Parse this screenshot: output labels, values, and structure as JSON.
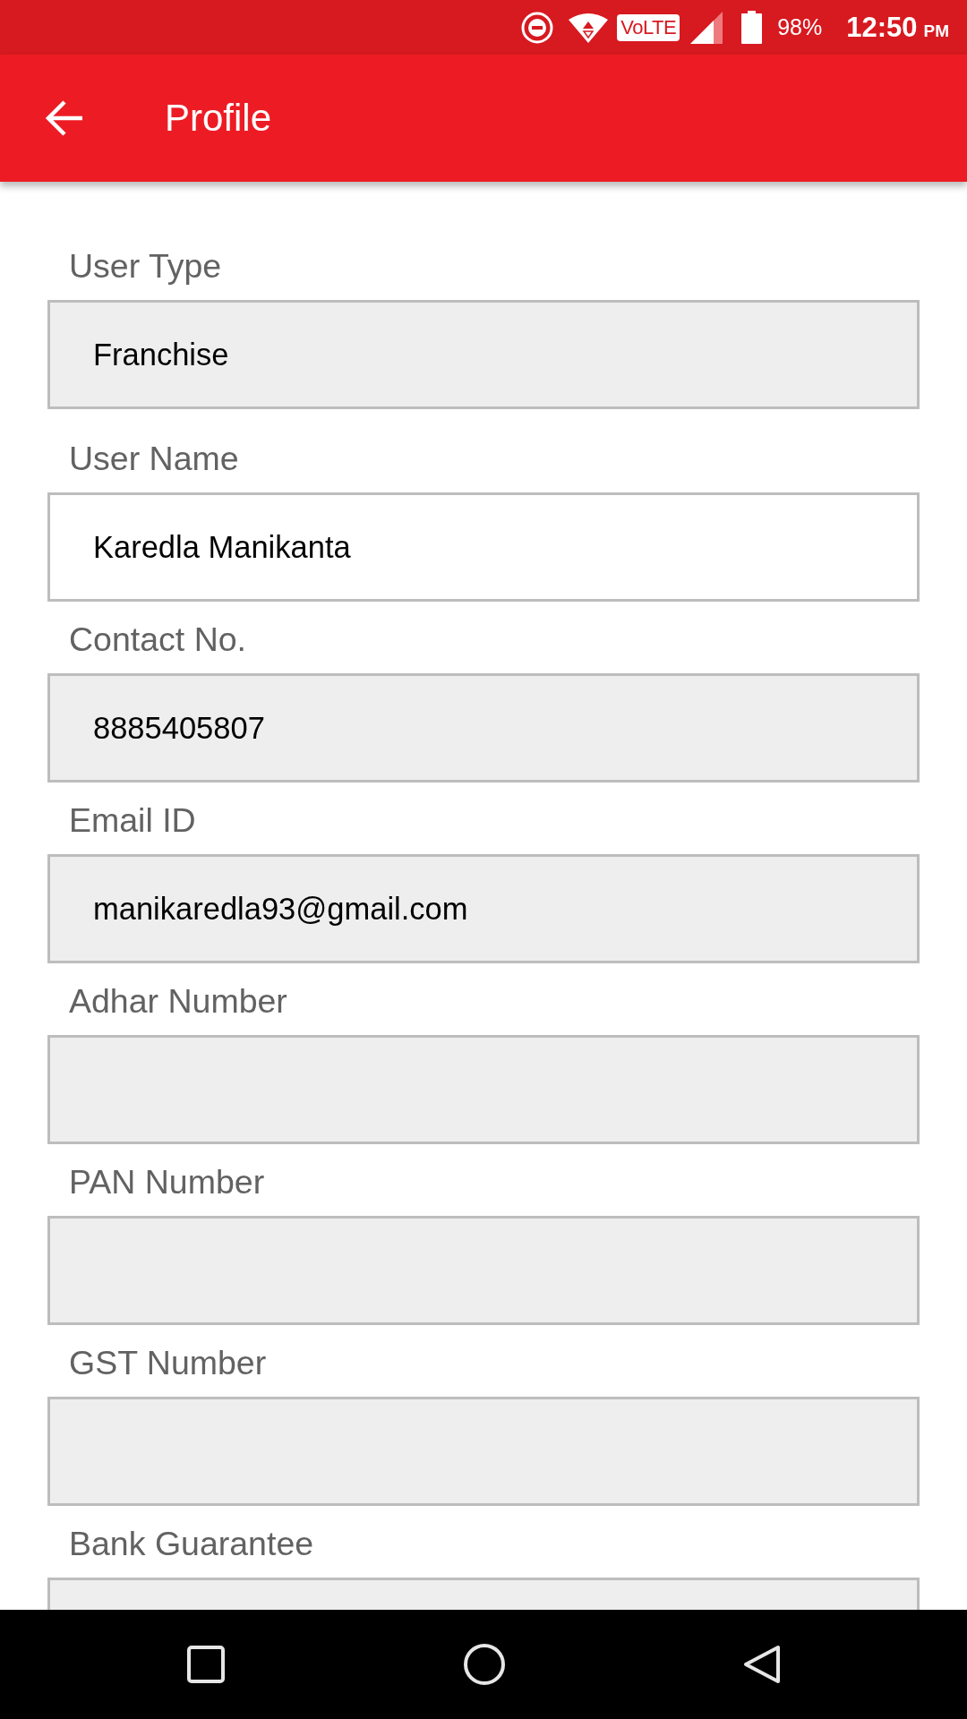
{
  "status_bar": {
    "network_badge": "VoLTE",
    "battery": "98%",
    "time": "12:50",
    "meridiem": "PM"
  },
  "app_bar": {
    "title": "Profile"
  },
  "fields": [
    {
      "label": "User Type",
      "value": "Franchise",
      "disabled": true
    },
    {
      "label": "User Name",
      "value": "Karedla Manikanta",
      "disabled": false
    },
    {
      "label": "Contact No.",
      "value": "8885405807",
      "disabled": true
    },
    {
      "label": "Email ID",
      "value": "manikaredla93@gmail.com",
      "disabled": true
    },
    {
      "label": "Adhar Number",
      "disabled": true
    },
    {
      "label": "PAN Number",
      "disabled": true
    },
    {
      "label": "GST Number",
      "disabled": true
    },
    {
      "label": "Bank Guarantee",
      "disabled": true
    }
  ]
}
